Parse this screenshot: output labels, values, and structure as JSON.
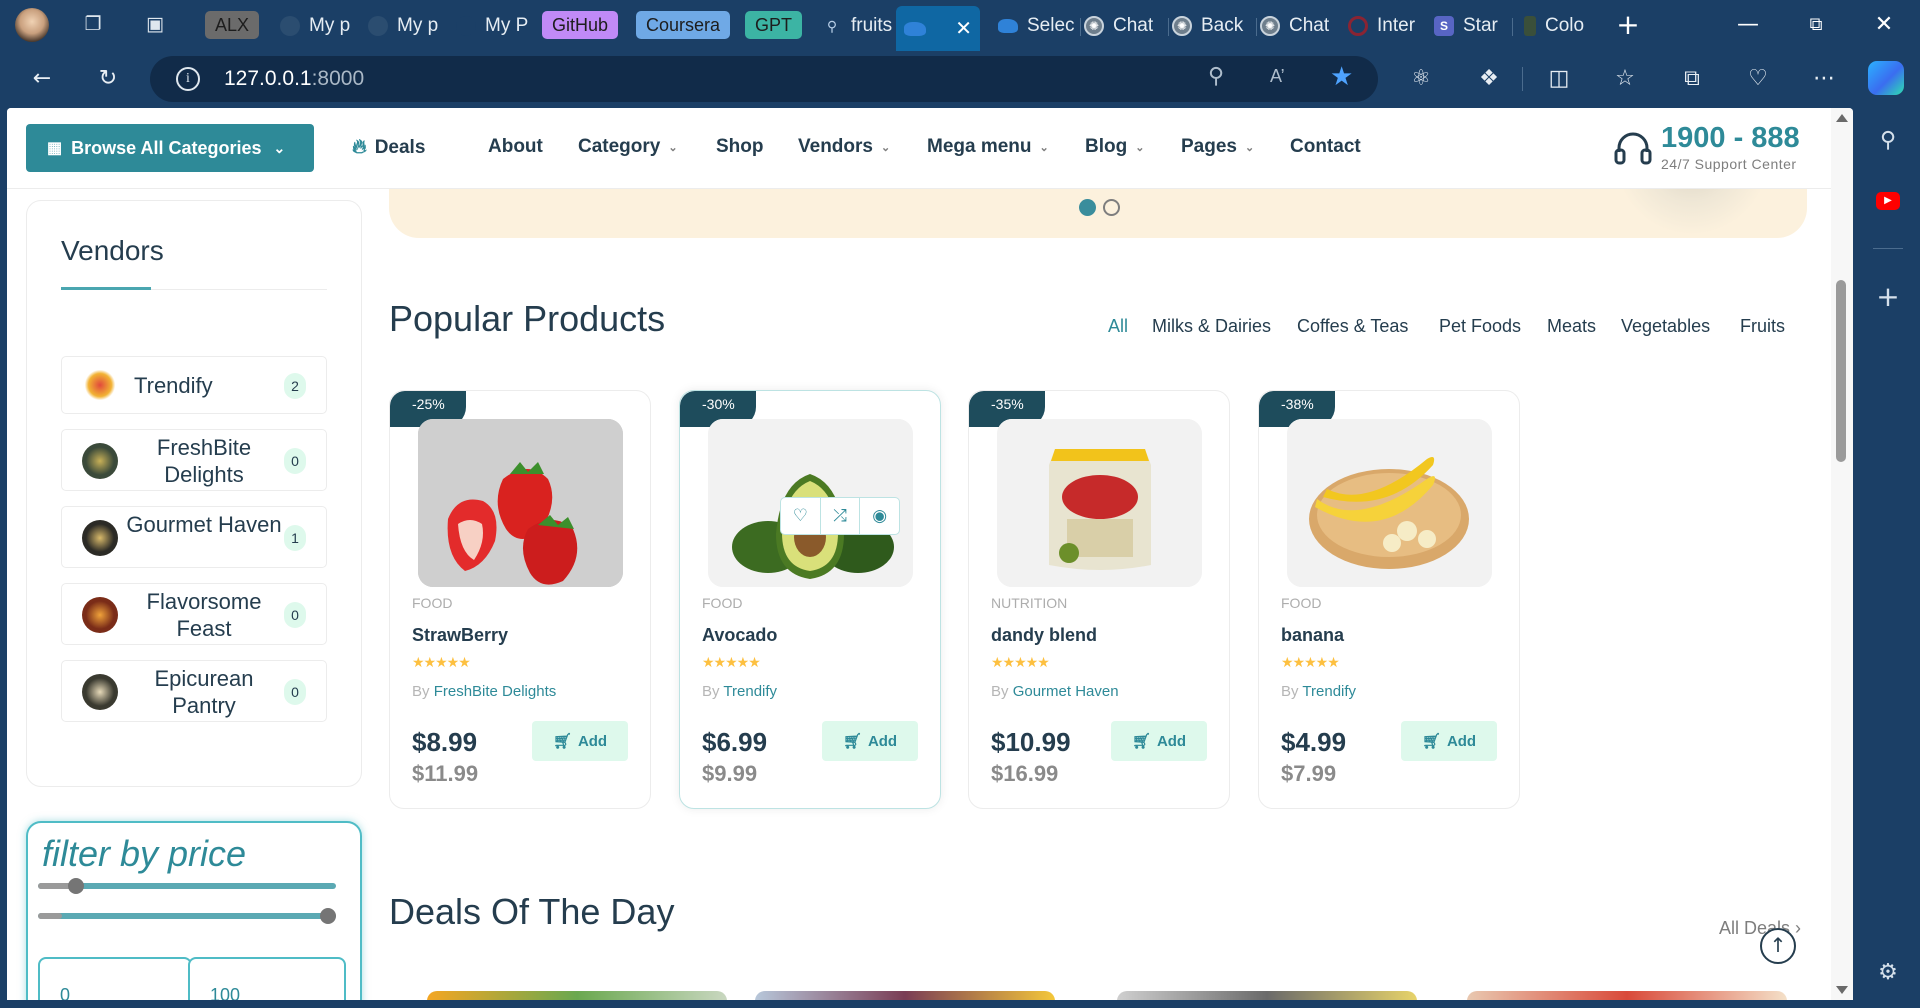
{
  "browser": {
    "tabs": [
      {
        "label": "ALX",
        "kind": "group"
      },
      {
        "label": "My p",
        "kind": "tab"
      },
      {
        "label": "My p",
        "kind": "tab"
      },
      {
        "label": "My P",
        "kind": "tab"
      },
      {
        "label": "GitHub",
        "kind": "group"
      },
      {
        "label": "Coursera",
        "kind": "group"
      },
      {
        "label": "GPT",
        "kind": "group"
      },
      {
        "label": "fruits",
        "kind": "tab"
      },
      {
        "label": "",
        "kind": "active"
      },
      {
        "label": "Selec",
        "kind": "tab"
      },
      {
        "label": "Chat",
        "kind": "tab"
      },
      {
        "label": "Back",
        "kind": "tab"
      },
      {
        "label": "Chat",
        "kind": "tab"
      },
      {
        "label": "Inter",
        "kind": "tab"
      },
      {
        "label": "Star",
        "kind": "tab"
      },
      {
        "label": "Colo",
        "kind": "tab"
      }
    ],
    "url_host": "127.0.0.1",
    "url_port": ":8000"
  },
  "header": {
    "browse_label": "Browse All Categories",
    "menu": [
      "Deals",
      "About",
      "Category",
      "Shop",
      "Vendors",
      "Mega menu",
      "Blog",
      "Pages",
      "Contact"
    ],
    "support_phone": "1900 - 888",
    "support_label": "24/7 Support Center"
  },
  "vendors": {
    "title": "Vendors",
    "items": [
      {
        "name": "Trendify",
        "count": "2"
      },
      {
        "name": "FreshBite Delights",
        "count": "0"
      },
      {
        "name": "Gourmet Haven",
        "count": "1"
      },
      {
        "name": "Flavorsome Feast",
        "count": "0"
      },
      {
        "name": "Epicurean Pantry",
        "count": "0"
      }
    ]
  },
  "filter": {
    "title": "filter by price",
    "min": "0",
    "max": "100"
  },
  "popular": {
    "title": "Popular Products",
    "tabs": [
      "All",
      "Milks & Dairies",
      "Coffes & Teas",
      "Pet Foods",
      "Meats",
      "Vegetables",
      "Fruits"
    ],
    "products": [
      {
        "badge": "-25%",
        "category": "FOOD",
        "name": "StrawBerry",
        "by": "By",
        "vendor": "FreshBite Delights",
        "price": "$8.99",
        "old_price": "$11.99",
        "add": "Add",
        "rating": 4.5
      },
      {
        "badge": "-30%",
        "category": "FOOD",
        "name": "Avocado",
        "by": "By",
        "vendor": "Trendify",
        "price": "$6.99",
        "old_price": "$9.99",
        "add": "Add",
        "rating": 4.5
      },
      {
        "badge": "-35%",
        "category": "NUTRITION",
        "name": "dandy blend",
        "by": "By",
        "vendor": "Gourmet Haven",
        "price": "$10.99",
        "old_price": "$16.99",
        "add": "Add",
        "rating": 4.5
      },
      {
        "badge": "-38%",
        "category": "FOOD",
        "name": "banana",
        "by": "By",
        "vendor": "Trendify",
        "price": "$4.99",
        "old_price": "$7.99",
        "add": "Add",
        "rating": 4.5
      }
    ]
  },
  "deals": {
    "title": "Deals Of The Day",
    "all_link": "All Deals"
  },
  "colors": {
    "teal": "#2e8a98",
    "dark_text": "#253d4e",
    "browser_bg": "#1b3f66"
  }
}
